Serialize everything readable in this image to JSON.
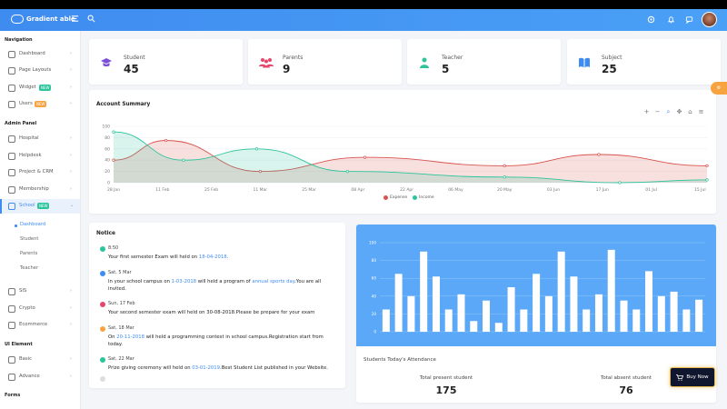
{
  "app": {
    "title": "Gradient able"
  },
  "sidebar": {
    "sections": [
      "Navigation",
      "Admin Panel",
      "UI Element",
      "Forms"
    ],
    "items": [
      {
        "label": "Dashboard",
        "badge": ""
      },
      {
        "label": "Page Layouts",
        "badge": ""
      },
      {
        "label": "Widget",
        "badge": "NEW"
      },
      {
        "label": "Users",
        "badge": "NEW"
      },
      {
        "label": "Hospital",
        "badge": ""
      },
      {
        "label": "Helpdesk",
        "badge": ""
      },
      {
        "label": "Project & CRM",
        "badge": ""
      },
      {
        "label": "Membership",
        "badge": ""
      },
      {
        "label": "School",
        "badge": "NEW"
      },
      {
        "label": "SIS",
        "badge": ""
      },
      {
        "label": "Crypto",
        "badge": ""
      },
      {
        "label": "Ecommerce",
        "badge": ""
      },
      {
        "label": "Basic",
        "badge": ""
      },
      {
        "label": "Advance",
        "badge": ""
      }
    ],
    "subitems": [
      "Dashboard",
      "Student",
      "Parents",
      "Teacher"
    ]
  },
  "stats": [
    {
      "label": "Student",
      "value": "45",
      "icon": "student-icon",
      "color": "#7b4fd6"
    },
    {
      "label": "Parents",
      "value": "9",
      "icon": "parents-icon",
      "color": "#e8456b"
    },
    {
      "label": "Teacher",
      "value": "5",
      "icon": "teacher-icon",
      "color": "#2cc49b"
    },
    {
      "label": "Subject",
      "value": "25",
      "icon": "book-icon",
      "color": "#3f8cf0"
    }
  ],
  "summary": {
    "title": "Account Summary",
    "toolbar": [
      "+",
      "−",
      "⌕",
      "✥",
      "⌂",
      "≡"
    ]
  },
  "chart_data": [
    {
      "type": "area",
      "title": "Account Summary",
      "x": [
        "28 Jan",
        "11 Feb",
        "25 Feb",
        "11 Mar",
        "25 Mar",
        "08 Apr",
        "22 Apr",
        "06 May",
        "20 May",
        "03 Jun",
        "17 Jun",
        "01 Jul",
        "15 Jul"
      ],
      "y_ticks": [
        0,
        20,
        40,
        60,
        80,
        100
      ],
      "ylim": [
        0,
        100
      ],
      "series": [
        {
          "name": "Expense",
          "color": "#d9534f",
          "points": [
            [
              "28 Jan",
              40
            ],
            [
              "12 Feb",
              75
            ],
            [
              "11 Mar",
              20
            ],
            [
              "10 Apr",
              45
            ],
            [
              "20 May",
              30
            ],
            [
              "16 Jun",
              50
            ],
            [
              "17 Jul",
              30
            ]
          ]
        },
        {
          "name": "Income",
          "color": "#2cc49b",
          "points": [
            [
              "28 Jan",
              90
            ],
            [
              "17 Feb",
              40
            ],
            [
              "10 Mar",
              60
            ],
            [
              "05 Apr",
              20
            ],
            [
              "20 May",
              10
            ],
            [
              "22 Jun",
              0
            ],
            [
              "17 Jul",
              5
            ]
          ]
        }
      ],
      "legend_position": "bottom-center",
      "grid": true
    },
    {
      "type": "bar",
      "ylim": [
        0,
        100
      ],
      "y_ticks": [
        0,
        20,
        40,
        60,
        80,
        100
      ],
      "values": [
        25,
        65,
        40,
        90,
        62,
        25,
        42,
        12,
        35,
        10,
        50,
        25,
        65,
        40,
        90,
        62,
        25,
        42,
        92,
        35,
        25,
        68,
        40,
        45,
        25,
        36
      ],
      "grid": true
    }
  ],
  "notice": {
    "title": "Notice",
    "items": [
      {
        "time": "8:50",
        "color": "#2cc49b",
        "pre": "Your first semester Exam will held on ",
        "link": "18-04-2018",
        "post": "."
      },
      {
        "time": "Sat, 5 Mar",
        "color": "#3f8cf0",
        "pre": "In your school campus on ",
        "link": "1-03-2018",
        "mid": " will held a program of ",
        "link2": "annual sports day",
        "post": ".You are all invited."
      },
      {
        "time": "Sun, 17 Feb",
        "color": "#e8456b",
        "pre": "Your second semester exam will held on 30-08-2018.Please be prepare for your exam",
        "link": "",
        "post": ""
      },
      {
        "time": "Sat, 18 Mar",
        "color": "#f7a440",
        "pre": "On ",
        "link": "20-11-2018",
        "post": " will held a programming contest in school campus.Registration start from today."
      },
      {
        "time": "Sat, 22 Mar",
        "color": "#2cc49b",
        "pre": "Prize giving ceremony will held on ",
        "link": "03-01-2019",
        "post": ".Best Student List published in your Website."
      }
    ]
  },
  "attendance": {
    "title": "Students Today's Attendance",
    "present_label": "Total present student",
    "present_value": "175",
    "absent_label": "Total absent student",
    "absent_value": "76"
  },
  "buy_button": {
    "label": "Buy Now"
  },
  "fab": {
    "label": "⚙"
  }
}
